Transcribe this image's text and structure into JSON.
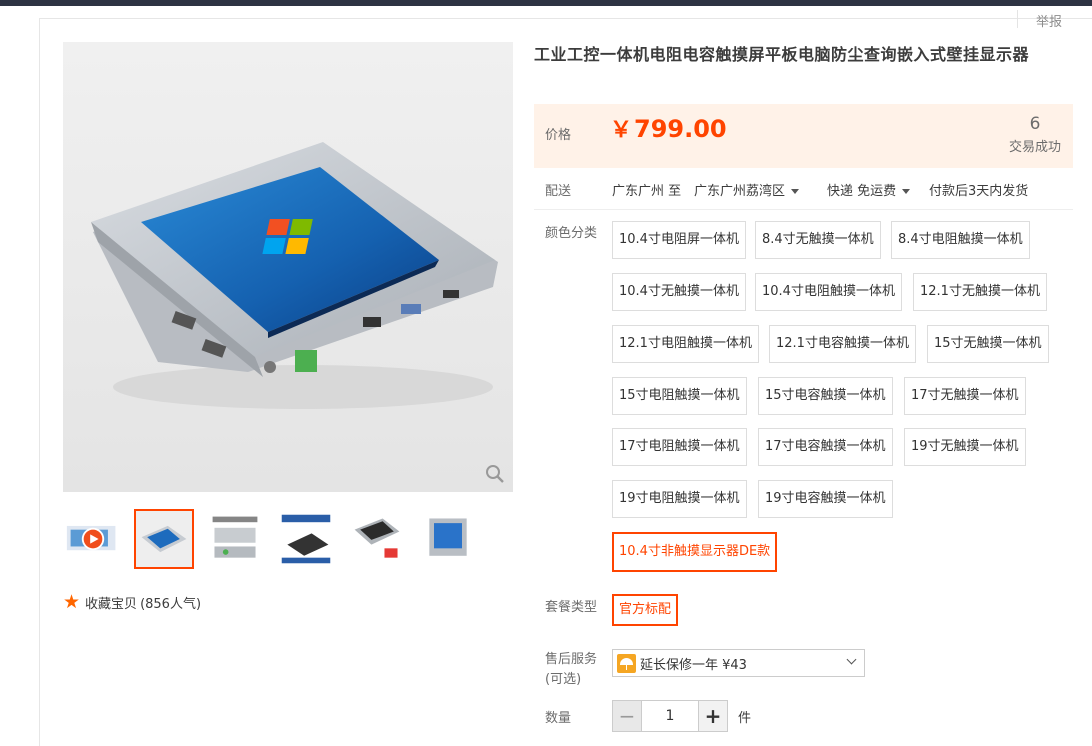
{
  "report_link": "举报",
  "product": {
    "title": "工业工控一体机电阻电容触摸屏平板电脑防尘查询嵌入式壁挂显示器"
  },
  "price": {
    "label": "价格",
    "currency": "￥",
    "amount": "799.00",
    "deals_count": "6",
    "deals_label": "交易成功"
  },
  "shipping": {
    "label": "配送",
    "from": "广东广州 至",
    "to": "广东广州荔湾区",
    "method": "快递 免运费",
    "dispatch": "付款后3天内发货"
  },
  "color": {
    "label": "颜色分类",
    "options": [
      "10.4寸电阻屏一体机",
      "8.4寸无触摸一体机",
      "8.4寸电阻触摸一体机",
      "10.4寸无触摸一体机",
      "10.4寸电阻触摸一体机",
      "12.1寸无触摸一体机",
      "12.1寸电阻触摸一体机",
      "12.1寸电容触摸一体机",
      "15寸无触摸一体机",
      "15寸电阻触摸一体机",
      "15寸电容触摸一体机",
      "17寸无触摸一体机",
      "17寸电阻触摸一体机",
      "17寸电容触摸一体机",
      "19寸无触摸一体机",
      "19寸电阻触摸一体机",
      "19寸电容触摸一体机",
      "10.4寸非触摸显示器DE款"
    ],
    "selected_index": 17
  },
  "package": {
    "label": "套餐类型",
    "option": "官方标配"
  },
  "after_sales": {
    "label_line1": "售后服务",
    "label_line2": "(可选)",
    "option": "延长保修一年 ¥43"
  },
  "quantity": {
    "label": "数量",
    "value": "1",
    "unit": "件"
  },
  "favorite": {
    "label": "收藏宝贝",
    "count": "(856人气)"
  },
  "colors": {
    "accent": "#ff4400",
    "price_bg": "#fff2e8"
  }
}
